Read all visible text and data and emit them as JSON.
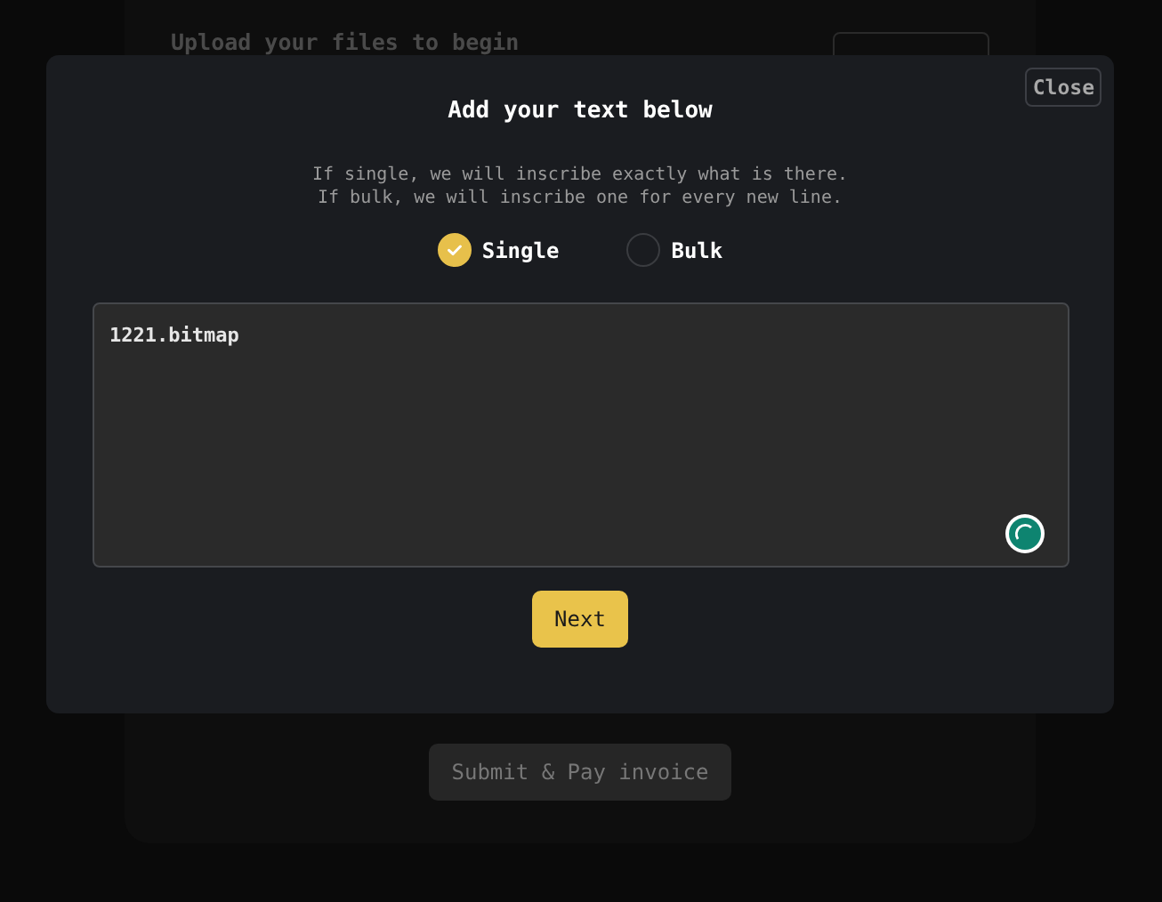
{
  "background": {
    "heading": "Upload your files to begin",
    "submit_button": "Submit & Pay invoice"
  },
  "modal": {
    "close": "Close",
    "title": "Add your text below",
    "description": [
      "If single, we will inscribe exactly what is there.",
      "If bulk, we will inscribe one for every new line."
    ],
    "modes": [
      {
        "label": "Single",
        "selected": true
      },
      {
        "label": "Bulk",
        "selected": false
      }
    ],
    "text_value": "1221.bitmap",
    "next_button": "Next"
  }
}
